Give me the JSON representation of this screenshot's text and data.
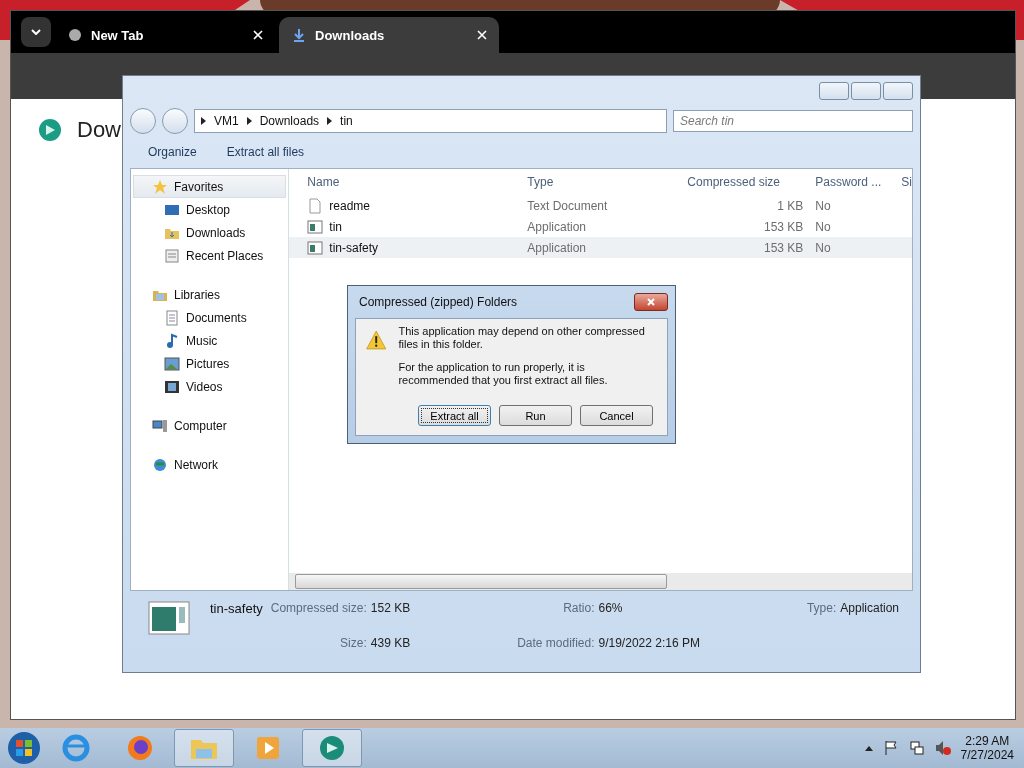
{
  "browser": {
    "tabs": [
      {
        "label": "New Tab",
        "selected": false
      },
      {
        "label": "Downloads",
        "selected": true
      }
    ],
    "page_heading": "Dow"
  },
  "explorer": {
    "breadcrumb": [
      "VM1",
      "Downloads",
      "tin"
    ],
    "search": {
      "placeholder": "Search tin"
    },
    "toolbar": [
      "Organize",
      "Extract all files"
    ],
    "nav": [
      {
        "label": "Favorites",
        "kind": "star",
        "selected": true,
        "children": [
          {
            "label": "Desktop",
            "kind": "desktop"
          },
          {
            "label": "Downloads",
            "kind": "folder"
          },
          {
            "label": "Recent Places",
            "kind": "recent"
          }
        ]
      },
      {
        "label": "Libraries",
        "kind": "library",
        "selected": false,
        "children": [
          {
            "label": "Documents",
            "kind": "doc"
          },
          {
            "label": "Music",
            "kind": "music"
          },
          {
            "label": "Pictures",
            "kind": "pictures"
          },
          {
            "label": "Videos",
            "kind": "videos"
          }
        ]
      },
      {
        "label": "Computer",
        "kind": "computer",
        "selected": false
      },
      {
        "label": "Network",
        "kind": "network",
        "selected": false
      }
    ],
    "columns": [
      "Name",
      "Type",
      "Compressed size",
      "Password ...",
      "Si"
    ],
    "rows": [
      {
        "name": "readme",
        "kind": "text",
        "type": "Text Document",
        "size": "1 KB",
        "password": "No",
        "hovered": false
      },
      {
        "name": "tin",
        "kind": "app",
        "type": "Application",
        "size": "153 KB",
        "password": "No",
        "hovered": false
      },
      {
        "name": "tin-safety",
        "kind": "app",
        "type": "Application",
        "size": "153 KB",
        "password": "No",
        "hovered": true
      }
    ],
    "details": {
      "name": "tin-safety",
      "fields": [
        {
          "label": "Compressed size:",
          "value": "152 KB"
        },
        {
          "label": "Ratio:",
          "value": "66%"
        },
        {
          "label": "Type:",
          "value": "Application"
        },
        {
          "label": "Size:",
          "value": "439 KB"
        },
        {
          "label": "Date modified:",
          "value": "9/19/2022 2:16 PM"
        }
      ]
    }
  },
  "dialog": {
    "title": "Compressed (zipped) Folders",
    "messages": [
      "This application may depend on other compressed files in this folder.",
      "For the application to run properly, it is recommended that you first extract all files."
    ],
    "buttons": [
      {
        "label": "Extract all",
        "default": true
      },
      {
        "label": "Run",
        "default": false
      },
      {
        "label": "Cancel",
        "default": false
      }
    ]
  },
  "taskbar": {
    "apps": [
      {
        "kind": "ie",
        "active": false
      },
      {
        "kind": "firefox",
        "active": false
      },
      {
        "kind": "explorer",
        "active": true
      },
      {
        "kind": "media",
        "active": false
      },
      {
        "kind": "browser",
        "active": true
      }
    ],
    "time": "2:29 AM",
    "date": "7/27/2024"
  }
}
